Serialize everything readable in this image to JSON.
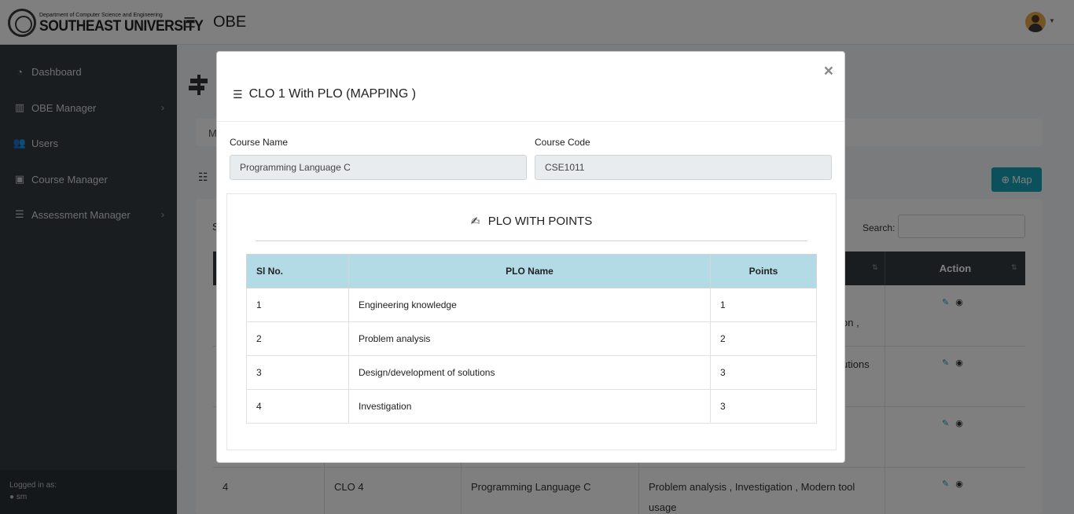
{
  "header": {
    "logo_top": "Department of Computer Science and Engineering",
    "logo_main": "SOUTHEAST UNIVERSITY",
    "app_title": "OBE"
  },
  "sidebar": {
    "items": [
      {
        "label": "Dashboard",
        "icon": "dashboard-icon",
        "has_arrow": false
      },
      {
        "label": "OBE Manager",
        "icon": "columns-icon",
        "has_arrow": true
      },
      {
        "label": "Users",
        "icon": "users-icon",
        "has_arrow": false
      },
      {
        "label": "Course Manager",
        "icon": "briefcase-icon",
        "has_arrow": false
      },
      {
        "label": "Assessment Manager",
        "icon": "bars-icon",
        "has_arrow": true
      }
    ],
    "logged_in_label": "Logged in as:",
    "username": "sm"
  },
  "background": {
    "breadcrumb_initial": "M",
    "map_button": "Map",
    "show_initial": "S",
    "search_label": "Search:",
    "action_header": "Action",
    "row4": {
      "sl": "4",
      "clo": "CLO 4",
      "course": "Programming Language C",
      "plos": "Problem analysis ,   Investigation ,   Modern tool usage"
    },
    "fragments": [
      "on ,",
      "utions"
    ]
  },
  "modal": {
    "title": "CLO 1 With PLO (MAPPING )",
    "close": "×",
    "course_name_label": "Course Name",
    "course_name_value": "Programming Language C",
    "course_code_label": "Course Code",
    "course_code_value": "CSE1011",
    "plo_heading": "PLO WITH POINTS",
    "table": {
      "headers": [
        "Sl No.",
        "PLO Name",
        "Points"
      ],
      "rows": [
        [
          "1",
          "Engineering knowledge",
          "1"
        ],
        [
          "2",
          "Problem analysis",
          "2"
        ],
        [
          "3",
          "Design/development of solutions",
          "3"
        ],
        [
          "4",
          "Investigation",
          "3"
        ]
      ]
    }
  },
  "colors": {
    "sidebar_bg": "#343a40",
    "table_header_bg": "#b3dbe6",
    "map_button_bg": "#17a2b8"
  }
}
